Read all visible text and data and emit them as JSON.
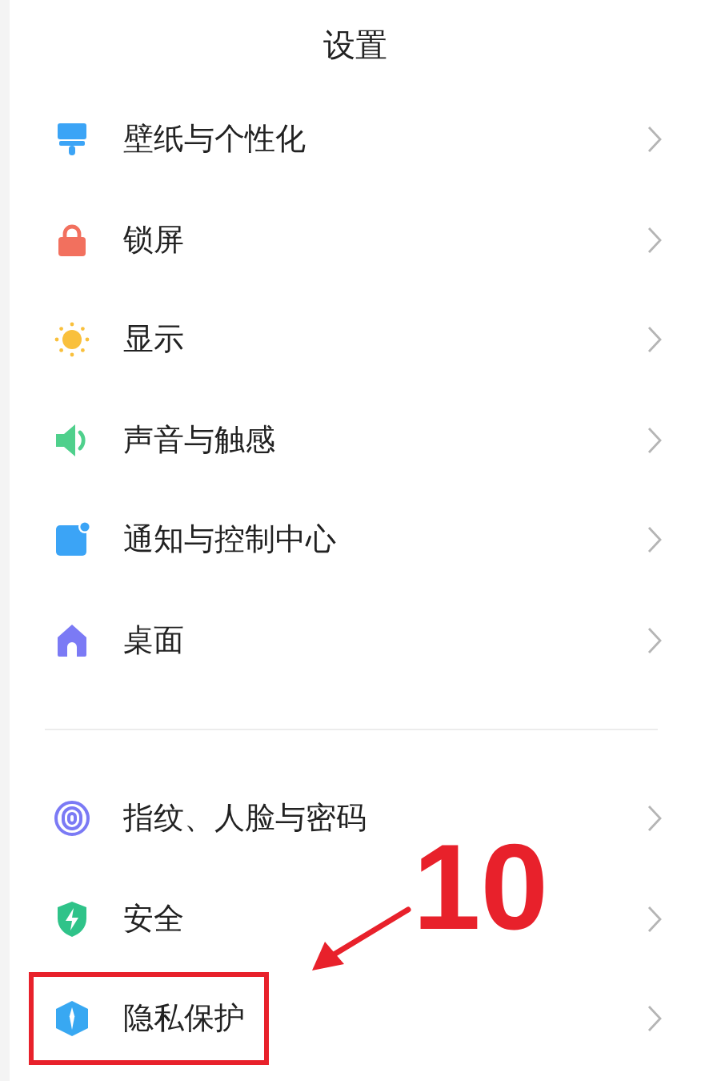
{
  "title": "设置",
  "groups": [
    {
      "items": [
        {
          "label": "壁纸与个性化",
          "kind": "wallpaper",
          "highlighted": false
        },
        {
          "label": "锁屏",
          "kind": "lock",
          "highlighted": false
        },
        {
          "label": "显示",
          "kind": "display",
          "highlighted": false
        },
        {
          "label": "声音与触感",
          "kind": "sound",
          "highlighted": false
        },
        {
          "label": "通知与控制中心",
          "kind": "notification",
          "highlighted": false
        },
        {
          "label": "桌面",
          "kind": "home",
          "highlighted": false
        }
      ]
    },
    {
      "items": [
        {
          "label": "指纹、人脸与密码",
          "kind": "fingerprint",
          "highlighted": false
        },
        {
          "label": "安全",
          "kind": "security",
          "highlighted": false
        },
        {
          "label": "隐私保护",
          "kind": "privacy",
          "highlighted": true
        }
      ]
    }
  ],
  "annotation": {
    "number": "10"
  }
}
